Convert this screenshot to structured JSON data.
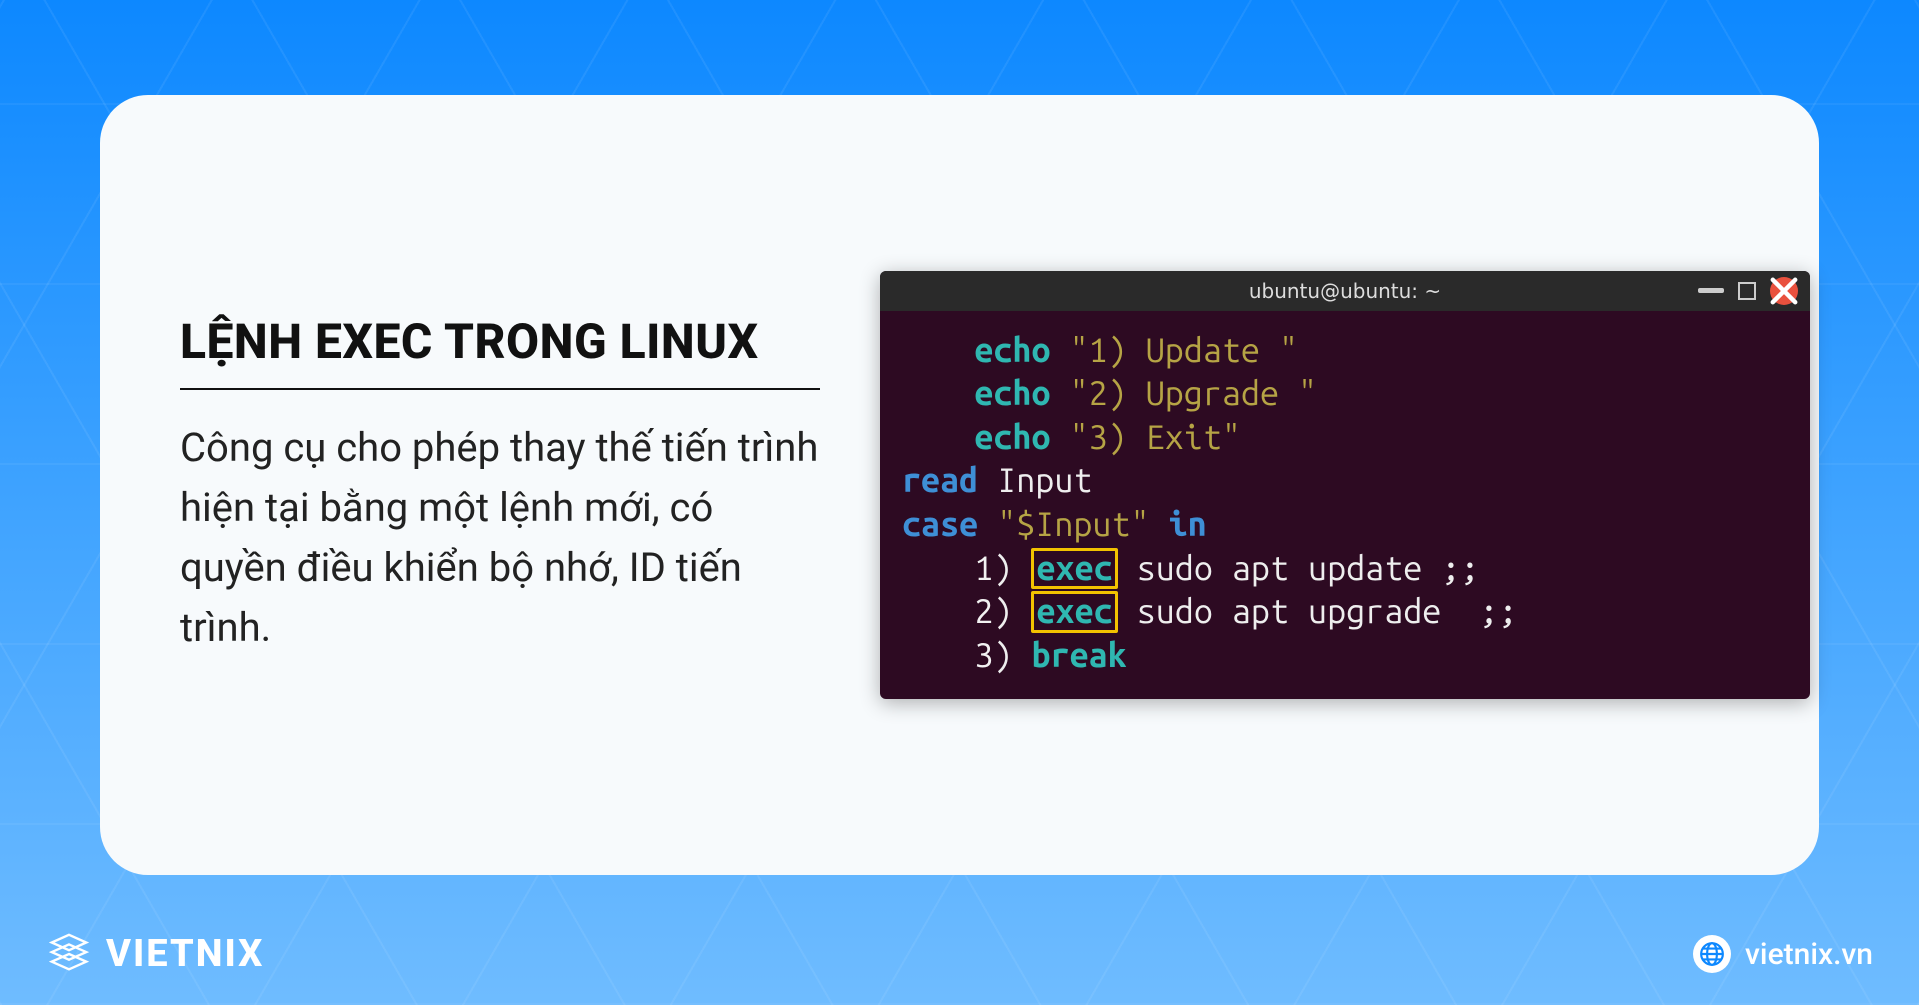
{
  "card": {
    "title": "LỆNH EXEC TRONG LINUX",
    "description": "Công cụ cho phép thay thế tiến trình hiện tại bằng một lệnh mới, có quyền điều khiển bộ nhớ, ID tiến trình."
  },
  "terminal": {
    "title": "ubuntu@ubuntu: ~",
    "lines": {
      "l1": {
        "cmd": "echo",
        "str": "\"1) Update \""
      },
      "l2": {
        "cmd": "echo",
        "str": "\"2) Upgrade \""
      },
      "l3": {
        "cmd": "echo",
        "str": "\"3) Exit\""
      },
      "l4": {
        "cmd": "read",
        "arg": "Input"
      },
      "l5": {
        "cmd": "case",
        "var": "\"$Input\"",
        "kw_in": "in"
      },
      "l6": {
        "num": "1",
        "paren": ")",
        "exec": "exec",
        "rest": " sudo apt update ;;"
      },
      "l7": {
        "num": "2",
        "paren": ")",
        "exec": "exec",
        "rest": " sudo apt upgrade  ;;"
      },
      "l8": {
        "num": "3",
        "paren": ")",
        "break": "break"
      }
    }
  },
  "footer": {
    "brand": "VIETNIX",
    "site": "vietnix.vn"
  },
  "icons": {
    "brand": "stack-cube-icon",
    "globe": "globe-icon",
    "min": "minimize-icon",
    "max": "maximize-icon",
    "close": "close-icon"
  },
  "colors": {
    "bg_top": "#0d88ff",
    "bg_bottom": "#6fbcff",
    "card_bg": "#f7fafc",
    "term_bg": "#2d0a22",
    "term_bar": "#2a2a2a",
    "highlight_border": "#f2c200",
    "syntax_teal": "#2fb7b1",
    "syntax_blue": "#3e8fd6",
    "syntax_yellow": "#b6a445",
    "close_red": "#e9513e"
  }
}
